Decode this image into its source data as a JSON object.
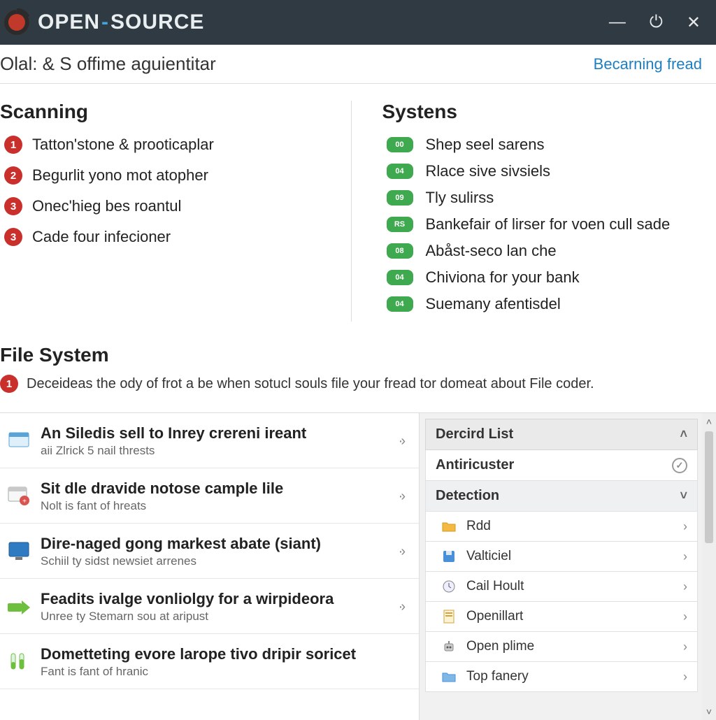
{
  "app": {
    "title_part1": "OPEN",
    "title_dash": "-",
    "title_part2": "SOURCE"
  },
  "secbar": {
    "left": "Olal: & S offime aguientitar",
    "right": "Becarning fread"
  },
  "scanning": {
    "heading": "Scanning",
    "items": [
      {
        "num": "1",
        "label": "Tatton'stone & prooticaplar"
      },
      {
        "num": "2",
        "label": "Begurlit yono mot atopher"
      },
      {
        "num": "3",
        "label": "Onec'hieg bes roantul"
      },
      {
        "num": "3",
        "label": "Cade four infecioner"
      }
    ]
  },
  "systems": {
    "heading": "Systens",
    "items": [
      {
        "pill": "00",
        "label": "Shep seel sarens"
      },
      {
        "pill": "04",
        "label": "Rlace sive sivsiels"
      },
      {
        "pill": "09",
        "label": "Tly sulirss"
      },
      {
        "pill": "RS",
        "label": "Bankefair of lirser for voen cull sade"
      },
      {
        "pill": "08",
        "label": "Abåst-seco lan che"
      },
      {
        "pill": "04",
        "label": "Chiviona for your bank"
      },
      {
        "pill": "04",
        "label": "Suemany afentisdel"
      }
    ]
  },
  "filesystem": {
    "heading": "File System",
    "badge": "1",
    "desc": "Deceideas the ody of frot a be when sotucl souls file your fread tor domeat about File coder."
  },
  "reports": [
    {
      "title": "An Siledis sell to Inrey crereni ireant",
      "sub": "aii Zlrick 5 nail thrests",
      "icon": "window-blue"
    },
    {
      "title": "Sit dle dravide notose cample lile",
      "sub": "Nolt is fant of hreats",
      "icon": "window-red"
    },
    {
      "title": "Dire-naged gong markest abate (siant)",
      "sub": "Schiil ty sidst newsiet arrenes",
      "icon": "window-blue2"
    },
    {
      "title": "Feadits ivalge vonliolgy for a wirpideora",
      "sub": "Unree ty Stemarn sou at aripust",
      "icon": "green-arrow"
    },
    {
      "title": "Dometteting evore larope tivo dripir soricet",
      "sub": "Fant is fant of hranic",
      "icon": "test-tubes"
    }
  ],
  "side": {
    "header": "Dercird List",
    "row1": "Antiricuster",
    "sub": "Detection",
    "items": [
      {
        "label": "Rdd",
        "icon": "folder"
      },
      {
        "label": "Valticiel",
        "icon": "disk"
      },
      {
        "label": "Cail Hoult",
        "icon": "clock"
      },
      {
        "label": "Openillart",
        "icon": "doc"
      },
      {
        "label": "Open plime",
        "icon": "bot"
      },
      {
        "label": "Top fanery",
        "icon": "folder-blue"
      }
    ]
  },
  "colors": {
    "accent_red": "#c9302c",
    "accent_green": "#3fa94f",
    "link": "#1e7fc0",
    "titlebar": "#2f3a42"
  }
}
